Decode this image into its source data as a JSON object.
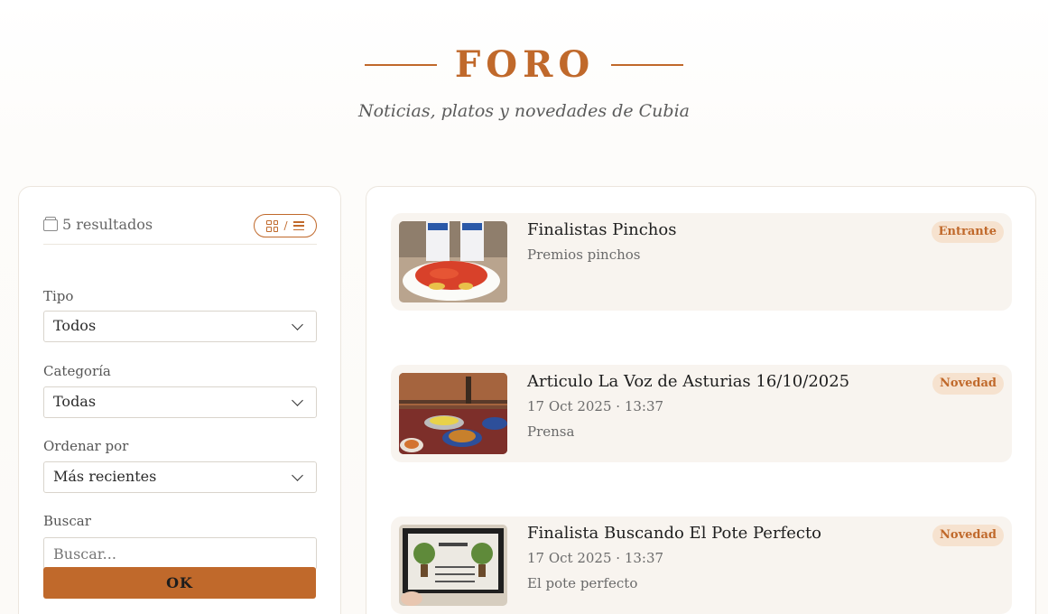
{
  "header": {
    "title": "FORO",
    "subtitle": "Noticias, platos y novedades de Cubia"
  },
  "sidebar": {
    "results_count": "5 resultados",
    "view_separator": "/",
    "filters": {
      "tipo_label": "Tipo",
      "tipo_value": "Todos",
      "categoria_label": "Categoría",
      "categoria_value": "Todas",
      "orden_label": "Ordenar por",
      "orden_value": "Más recientes",
      "buscar_label": "Buscar",
      "buscar_placeholder": "Buscar...",
      "ok_label": "OK"
    }
  },
  "posts": [
    {
      "title": "Finalistas Pinchos",
      "date": "",
      "category": "Premios pinchos",
      "badge": "Entrante"
    },
    {
      "title": "Articulo La Voz de Asturias 16/10/2025",
      "date": "17 Oct 2025 · 13:37",
      "category": "Prensa",
      "badge": "Novedad"
    },
    {
      "title": "Finalista Buscando El Pote Perfecto",
      "date": "17 Oct 2025 · 13:37",
      "category": "El pote perfecto",
      "badge": "Novedad"
    }
  ],
  "colors": {
    "accent": "#c0692b",
    "badge_bg": "#f6e2cf",
    "card_bg": "#f8f4ef"
  },
  "icons": {
    "results": "tray-icon",
    "grid_view": "grid-icon",
    "list_view": "list-icon",
    "select_chevron": "chevron-down-icon"
  }
}
